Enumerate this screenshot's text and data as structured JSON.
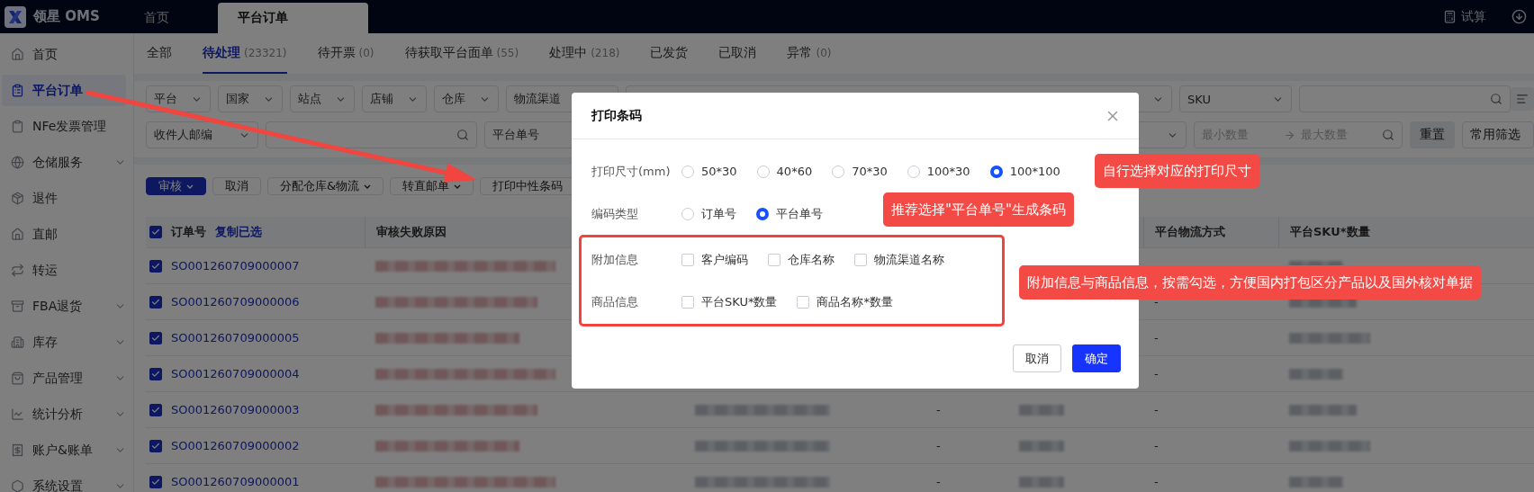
{
  "top_bar": {
    "brand": "领星 OMS",
    "tabs": [
      {
        "label": "首页",
        "selected": false
      },
      {
        "label": "平台订单",
        "selected": true
      }
    ],
    "tool": "试算"
  },
  "sidebar": {
    "items": [
      {
        "label": "首页",
        "selected": false,
        "expandable": false
      },
      {
        "label": "平台订单",
        "selected": true,
        "expandable": false
      },
      {
        "label": "NFe发票管理",
        "selected": false,
        "expandable": false
      },
      {
        "label": "仓储服务",
        "selected": false,
        "expandable": true
      },
      {
        "label": "退件",
        "selected": false,
        "expandable": false
      },
      {
        "label": "直邮",
        "selected": false,
        "expandable": false
      },
      {
        "label": "转运",
        "selected": false,
        "expandable": false
      },
      {
        "label": "FBA退货",
        "selected": false,
        "expandable": true
      },
      {
        "label": "库存",
        "selected": false,
        "expandable": true
      },
      {
        "label": "产品管理",
        "selected": false,
        "expandable": true
      },
      {
        "label": "统计分析",
        "selected": false,
        "expandable": true
      },
      {
        "label": "账户&账单",
        "selected": false,
        "expandable": true
      },
      {
        "label": "系统设置",
        "selected": false,
        "expandable": true
      }
    ]
  },
  "status_tabs": [
    {
      "label": "全部",
      "selected": false
    },
    {
      "label": "待处理",
      "count": "(23321)",
      "selected": true
    },
    {
      "label": "待开票",
      "count": "(0)",
      "selected": false
    },
    {
      "label": "待获取平台面单",
      "count": "(55)",
      "selected": false
    },
    {
      "label": "处理中",
      "count": "(218)",
      "selected": false
    },
    {
      "label": "已发货",
      "selected": false
    },
    {
      "label": "已取消",
      "selected": false
    },
    {
      "label": "异常",
      "count": "(0)",
      "selected": false
    }
  ],
  "filters": {
    "row_1": [
      {
        "kind": "select",
        "label": "平台"
      },
      {
        "kind": "select",
        "label": "国家"
      },
      {
        "kind": "select",
        "label": "站点"
      },
      {
        "kind": "select",
        "label": "店铺"
      },
      {
        "kind": "select",
        "label": "仓库"
      },
      {
        "kind": "wide_select",
        "label": "物流渠道"
      },
      {
        "kind": "filler"
      },
      {
        "kind": "wide_select",
        "label": "SKU"
      },
      {
        "kind": "search"
      },
      {
        "kind": "menu"
      }
    ],
    "row_2": [
      {
        "kind": "wide_select",
        "label": "收件人邮编"
      },
      {
        "kind": "search"
      },
      {
        "kind": "wide_select",
        "label": "平台单号"
      },
      {
        "kind": "filler"
      },
      {
        "kind": "range",
        "placeholder_min": "最小数量",
        "placeholder_max": "最大数量"
      },
      {
        "kind": "gray_button",
        "label": "重置"
      },
      {
        "kind": "outline_button",
        "label": "常用筛选"
      }
    ]
  },
  "actions": [
    {
      "label": "审核",
      "primary": true,
      "dropdown": true
    },
    {
      "label": "取消",
      "primary": false,
      "dropdown": false
    },
    {
      "label": "分配仓库&物流",
      "primary": false,
      "dropdown": true
    },
    {
      "label": "转直邮单",
      "primary": false,
      "dropdown": true
    },
    {
      "label": "打印中性条码",
      "primary": false,
      "dropdown": false
    }
  ],
  "table": {
    "all_checked": true,
    "copy_link": "复制已选",
    "columns": [
      {
        "label": "订单号"
      },
      {
        "label": "审核失败原因"
      },
      {},
      {},
      {},
      {
        "label": "平台物流方式"
      },
      {
        "label": "平台SKU*数量"
      }
    ],
    "rows": [
      {
        "order_no": "SO001260709000007",
        "checked": true
      },
      {
        "order_no": "SO001260709000006",
        "checked": true,
        "logistics": "-"
      },
      {
        "order_no": "SO001260709000005",
        "checked": true,
        "logistics": "-"
      },
      {
        "order_no": "SO001260709000004",
        "checked": true,
        "logistics": "-"
      },
      {
        "order_no": "SO001260709000003",
        "checked": true,
        "column_4": "-",
        "logistics": "-"
      },
      {
        "order_no": "SO001260709000002",
        "checked": true,
        "column_4": "-",
        "logistics": "-"
      },
      {
        "order_no": "SO001260709000001",
        "checked": true,
        "column_4": "-",
        "logistics": "-"
      }
    ]
  },
  "dialog": {
    "title": "打印条码",
    "fields": [
      {
        "kind": "radio",
        "label": "打印尺寸(mm)",
        "options": [
          {
            "label": "50*30",
            "selected": false
          },
          {
            "label": "40*60",
            "selected": false
          },
          {
            "label": "70*30",
            "selected": false
          },
          {
            "label": "100*30",
            "selected": false
          },
          {
            "label": "100*100",
            "selected": true
          }
        ]
      },
      {
        "kind": "radio",
        "label": "编码类型",
        "options": [
          {
            "label": "订单号",
            "selected": false
          },
          {
            "label": "平台单号",
            "selected": true
          }
        ]
      },
      {
        "kind": "checkbox",
        "label": "附加信息",
        "options": [
          {
            "label": "客户编码",
            "checked": false
          },
          {
            "label": "仓库名称",
            "checked": false
          },
          {
            "label": "物流渠道名称",
            "checked": false
          }
        ]
      },
      {
        "kind": "checkbox",
        "label": "商品信息",
        "options": [
          {
            "label": "平台SKU*数量",
            "checked": false
          },
          {
            "label": "商品名称*数量",
            "checked": false
          }
        ]
      }
    ],
    "buttons": [
      {
        "label": "取消",
        "primary": false
      },
      {
        "label": "确定",
        "primary": true
      }
    ]
  },
  "callouts": [
    "自行选择对应的打印尺寸",
    "推荐选择\"平台单号\"生成条码",
    "附加信息与商品信息，按需勾选，方便国内打包区分产品以及国外核对单据"
  ]
}
